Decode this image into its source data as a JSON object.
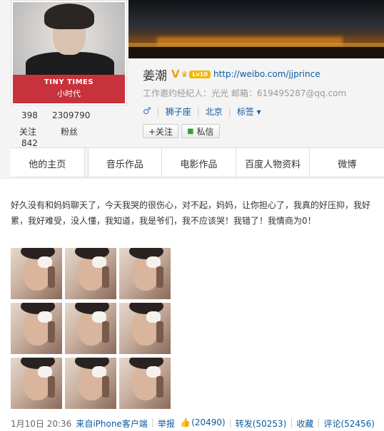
{
  "profile": {
    "avatar_brand_en": "TINY TIMES",
    "avatar_brand_cn": "小时代",
    "name": "姜潮",
    "verified_mark": "V",
    "level_badge": "Lv10",
    "home_url": "http://weibo.com/jjprince",
    "work_contact": "工作邀约经纪人：光光 邮箱：619495287@qq.com",
    "gender_symbol": "♂",
    "zodiac": "狮子座",
    "location": "北京",
    "tags_label": "标签 ▾",
    "follow_button": "+关注",
    "message_button": "私信"
  },
  "counts": {
    "following": "398",
    "following_label": "关注",
    "fans": "2309790",
    "fans_label": "粉丝",
    "posts": "842"
  },
  "tabs": [
    "他的主页",
    "音乐作品",
    "电影作品",
    "百度人物资料",
    "微博"
  ],
  "post": {
    "text": "好久没有和妈妈聊天了，今天我哭的很伤心，对不起，妈妈，让你担心了，我真的好压抑，我好累，我好难受，没人懂，我知道，我是爷们，我不应该哭！我错了！我情商为0！",
    "images": [
      {
        "icon": "selfie-photo"
      },
      {
        "icon": "selfie-photo"
      },
      {
        "icon": "selfie-photo"
      },
      {
        "icon": "selfie-photo"
      },
      {
        "icon": "selfie-photo"
      },
      {
        "icon": "selfie-photo"
      },
      {
        "icon": "selfie-photo"
      },
      {
        "icon": "selfie-photo"
      },
      {
        "icon": "selfie-photo"
      }
    ],
    "timestamp": "1月10日 20:36",
    "source": "来自iPhone客户端",
    "report": "举报",
    "likes": "(20490)",
    "repost": "转发(50253)",
    "favorite": "收藏",
    "comment": "评论(52456)"
  },
  "colors": {
    "link": "#0a5aa0",
    "brand_red": "#c7323c",
    "level_gold": "#f2b705",
    "follow_orange": "#f07810"
  }
}
